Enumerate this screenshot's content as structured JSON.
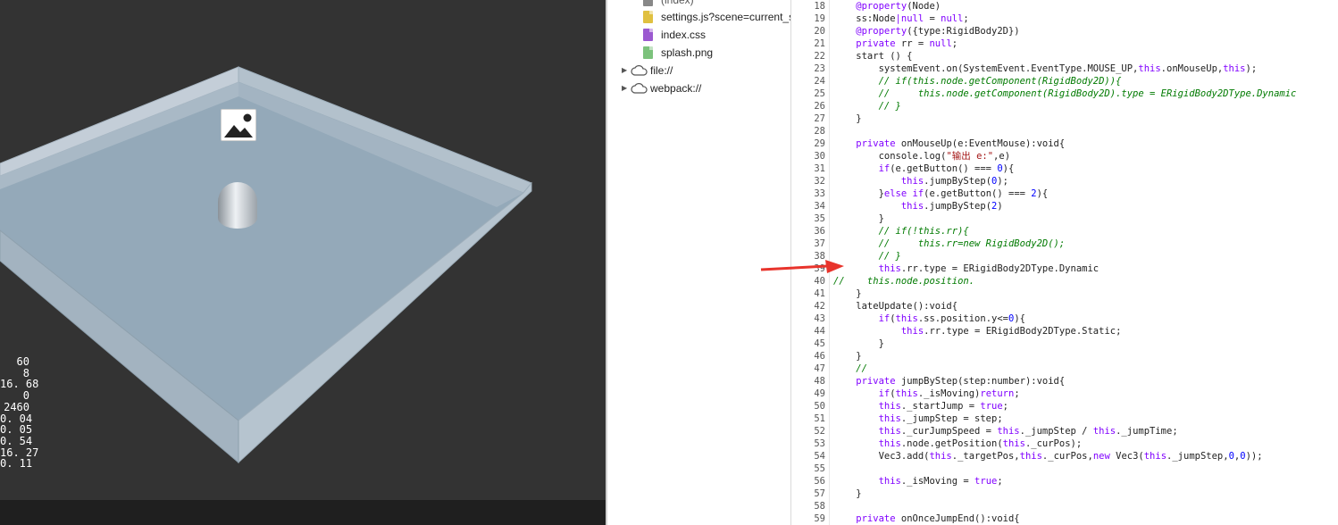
{
  "stats": {
    "values": [
      "60",
      "8",
      "16. 68",
      "0",
      "2460",
      "0. 04",
      "0. 05",
      "0. 54",
      "16. 27",
      "0. 11"
    ]
  },
  "file_tree": {
    "items": [
      {
        "label": "(index)",
        "icon": "document-icon",
        "color": "#888888"
      },
      {
        "label": "settings.js?scene=current_s",
        "icon": "js-file-icon",
        "color": "#e0c040"
      },
      {
        "label": "index.css",
        "icon": "css-file-icon",
        "color": "#9b59d0"
      },
      {
        "label": "splash.png",
        "icon": "image-file-icon",
        "color": "#7cc27c"
      }
    ],
    "folders": [
      {
        "label": "file://",
        "icon": "cloud-icon"
      },
      {
        "label": "webpack://",
        "icon": "cloud-icon"
      }
    ]
  },
  "editor": {
    "line_numbers": [
      "18",
      "19",
      "20",
      "21",
      "22",
      "23",
      "24",
      "25",
      "26",
      "27",
      "28",
      "29",
      "30",
      "31",
      "32",
      "33",
      "34",
      "35",
      "36",
      "37",
      "38",
      "39",
      "40",
      "41",
      "42",
      "43",
      "44",
      "45",
      "46",
      "47",
      "48",
      "49",
      "50",
      "51",
      "52",
      "53",
      "54",
      "55",
      "56",
      "57",
      "58",
      "59"
    ],
    "lines": [
      [
        [
          "kw",
          "    @property"
        ],
        [
          "pl",
          "(Node)"
        ]
      ],
      [
        [
          "pl",
          "    ss:Node"
        ],
        [
          "kw",
          "|null"
        ],
        [
          "pl",
          " = "
        ],
        [
          "kw",
          "null"
        ],
        [
          "pl",
          ";"
        ]
      ],
      [
        [
          "kw",
          "    @property"
        ],
        [
          "pl",
          "({type:RigidBody2D})"
        ]
      ],
      [
        [
          "kw",
          "    private"
        ],
        [
          "pl",
          " rr = "
        ],
        [
          "kw",
          "null"
        ],
        [
          "pl",
          ";"
        ]
      ],
      [
        [
          "pl",
          "    start () {"
        ]
      ],
      [
        [
          "pl",
          "        systemEvent.on(SystemEvent.EventType.MOUSE_UP,"
        ],
        [
          "kw",
          "this"
        ],
        [
          "pl",
          ".onMouseUp,"
        ],
        [
          "kw",
          "this"
        ],
        [
          "pl",
          ");"
        ]
      ],
      [
        [
          "cm",
          "        // if(this.node.getComponent(RigidBody2D)){"
        ]
      ],
      [
        [
          "cm",
          "        //     this.node.getComponent(RigidBody2D).type = ERigidBody2DType.Dynamic"
        ]
      ],
      [
        [
          "cm",
          "        // }"
        ]
      ],
      [
        [
          "pl",
          "    }"
        ]
      ],
      [
        [
          "pl",
          ""
        ]
      ],
      [
        [
          "kw",
          "    private"
        ],
        [
          "pl",
          " onMouseUp(e:EventMouse):void{"
        ]
      ],
      [
        [
          "pl",
          "        console.log("
        ],
        [
          "st",
          "\"输出 e:\""
        ],
        [
          "pl",
          ",e)"
        ]
      ],
      [
        [
          "kw",
          "        if"
        ],
        [
          "pl",
          "(e.getButton() === "
        ],
        [
          "nm",
          "0"
        ],
        [
          "pl",
          "){"
        ]
      ],
      [
        [
          "kw",
          "            this"
        ],
        [
          "pl",
          ".jumpByStep("
        ],
        [
          "nm",
          "0"
        ],
        [
          "pl",
          ");"
        ]
      ],
      [
        [
          "pl",
          "        }"
        ],
        [
          "kw",
          "else if"
        ],
        [
          "pl",
          "(e.getButton() === "
        ],
        [
          "nm",
          "2"
        ],
        [
          "pl",
          "){"
        ]
      ],
      [
        [
          "kw",
          "            this"
        ],
        [
          "pl",
          ".jumpByStep("
        ],
        [
          "nm",
          "2"
        ],
        [
          "pl",
          ")"
        ]
      ],
      [
        [
          "pl",
          "        }"
        ]
      ],
      [
        [
          "cm",
          "        // if(!this.rr){"
        ]
      ],
      [
        [
          "cm",
          "        //     this.rr=new RigidBody2D();"
        ]
      ],
      [
        [
          "cm",
          "        // }"
        ]
      ],
      [
        [
          "kw",
          "        this"
        ],
        [
          "pl",
          ".rr.type = ERigidBody2DType.Dynamic"
        ]
      ],
      [
        [
          "cm",
          "//    this.node.position."
        ]
      ],
      [
        [
          "pl",
          "    }"
        ]
      ],
      [
        [
          "pl",
          "    lateUpdate():void{"
        ]
      ],
      [
        [
          "kw",
          "        if"
        ],
        [
          "pl",
          "("
        ],
        [
          "kw",
          "this"
        ],
        [
          "pl",
          ".ss.position.y<="
        ],
        [
          "nm",
          "0"
        ],
        [
          "pl",
          "){"
        ]
      ],
      [
        [
          "kw",
          "            this"
        ],
        [
          "pl",
          ".rr.type = ERigidBody2DType.Static;"
        ]
      ],
      [
        [
          "pl",
          "        }"
        ]
      ],
      [
        [
          "pl",
          "    }"
        ]
      ],
      [
        [
          "cm",
          "    //"
        ]
      ],
      [
        [
          "kw",
          "    private"
        ],
        [
          "pl",
          " jumpByStep(step:number):void{"
        ]
      ],
      [
        [
          "kw",
          "        if"
        ],
        [
          "pl",
          "("
        ],
        [
          "kw",
          "this"
        ],
        [
          "pl",
          "._isMoving)"
        ],
        [
          "kw",
          "return"
        ],
        [
          "pl",
          ";"
        ]
      ],
      [
        [
          "kw",
          "        this"
        ],
        [
          "pl",
          "._startJump = "
        ],
        [
          "kw",
          "true"
        ],
        [
          "pl",
          ";"
        ]
      ],
      [
        [
          "kw",
          "        this"
        ],
        [
          "pl",
          "._jumpStep = step;"
        ]
      ],
      [
        [
          "kw",
          "        this"
        ],
        [
          "pl",
          "._curJumpSpeed = "
        ],
        [
          "kw",
          "this"
        ],
        [
          "pl",
          "._jumpStep / "
        ],
        [
          "kw",
          "this"
        ],
        [
          "pl",
          "._jumpTime;"
        ]
      ],
      [
        [
          "kw",
          "        this"
        ],
        [
          "pl",
          ".node.getPosition("
        ],
        [
          "kw",
          "this"
        ],
        [
          "pl",
          "._curPos);"
        ]
      ],
      [
        [
          "pl",
          "        Vec3.add("
        ],
        [
          "kw",
          "this"
        ],
        [
          "pl",
          "._targetPos,"
        ],
        [
          "kw",
          "this"
        ],
        [
          "pl",
          "._curPos,"
        ],
        [
          "kw",
          "new"
        ],
        [
          "pl",
          " Vec3("
        ],
        [
          "kw",
          "this"
        ],
        [
          "pl",
          "._jumpStep,"
        ],
        [
          "nm",
          "0"
        ],
        [
          "pl",
          ","
        ],
        [
          "nm",
          "0"
        ],
        [
          "pl",
          "));"
        ]
      ],
      [
        [
          "pl",
          ""
        ]
      ],
      [
        [
          "kw",
          "        this"
        ],
        [
          "pl",
          "._isMoving = "
        ],
        [
          "kw",
          "true"
        ],
        [
          "pl",
          ";"
        ]
      ],
      [
        [
          "pl",
          "    }"
        ]
      ],
      [
        [
          "pl",
          ""
        ]
      ],
      [
        [
          "kw",
          "    private"
        ],
        [
          "pl",
          " onOnceJumpEnd():void{"
        ]
      ]
    ]
  },
  "colors": {
    "viewport_bg": "#333333",
    "platform_top": "#94a9b9",
    "wall": "#c0ccd6",
    "arrow": "#e8342c"
  }
}
